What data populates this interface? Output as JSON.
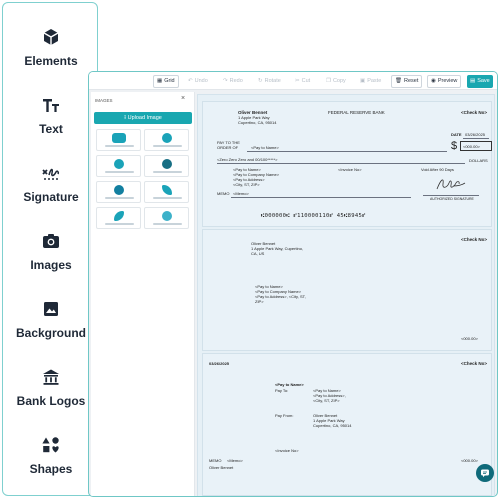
{
  "sidebar": {
    "items": [
      {
        "label": "Elements",
        "icon": "cube-icon"
      },
      {
        "label": "Text",
        "icon": "text-size-icon"
      },
      {
        "label": "Signature",
        "icon": "signature-icon"
      },
      {
        "label": "Images",
        "icon": "camera-icon"
      },
      {
        "label": "Background",
        "icon": "image-icon"
      },
      {
        "label": "Bank Logos",
        "icon": "bank-icon"
      },
      {
        "label": "Shapes",
        "icon": "shapes-icon"
      }
    ]
  },
  "toolbar": {
    "grid": "Grid",
    "undo": "Undo",
    "redo": "Redo",
    "rotate": "Rotate",
    "cut": "Cut",
    "copy": "Copy",
    "paste": "Paste",
    "reset": "Reset",
    "preview": "Preview",
    "save": "Save"
  },
  "images_panel": {
    "title": "IMAGES",
    "close": "×",
    "upload_label": "Upload Image"
  },
  "check1": {
    "payer_name": "Oliver Bennet",
    "payer_addr1": "1 Apple Park Way",
    "payer_addr2": "Cupertino, CA, 95014",
    "bank": "FEDERAL RESERVE BANK",
    "check_no": "<Check No>",
    "date_label": "DATE",
    "date": "03/26/2025",
    "pay_to_line1": "PAY TO THE",
    "pay_to_line2": "ORDER OF",
    "payee": "<Pay to Name>",
    "dollar_sign": "$",
    "amount": "<000.00>",
    "amount_words": "<Zero Zero Zero and 00/100*****>",
    "dollars": "DOLLARS",
    "addr_name": "<Pay to Name>",
    "addr_company": "<Pay to Company Name>",
    "addr_line": "<Pay to Address>",
    "addr_city": "<City, ST, ZIP>",
    "invoice": "<Invoice No>",
    "void": "Void After 90 Days",
    "memo_label": "MEMO",
    "memo": "<Memo>",
    "auth_sig": "AUTHORIZED SIGNATURE",
    "micr": "⑆000000⑆ ⑈110000110⑈ 45⑆8945⑈"
  },
  "stub1": {
    "payer_name": "Oliver Bennet",
    "payer_addr1": "1 Apple Park Way, Cupertino,",
    "payer_addr2": "CA, US",
    "check_no": "<Check No>",
    "to_name": "<Pay to Name>",
    "to_company": "<Pay to Company Name>",
    "to_address": "<Pay to Address>, <City, ST,",
    "to_zip": "ZIP>",
    "amount": "<000.00>"
  },
  "stub2": {
    "date": "03/26/2025",
    "check_no": "<Check No>",
    "pay_to_name": "<Pay to Name>",
    "pay_to_label": "Pay To:",
    "pt_name": "<Pay to Name>",
    "pt_address": "<Pay to Address>,",
    "pt_city": "<City, ST, ZIP>",
    "pay_from_label": "Pay From:",
    "pf_name": "Oliver Bennet",
    "pf_addr1": "1 Apple Park Way",
    "pf_addr2": "Cupertino, CA, 95014",
    "invoice": "<Invoice No>",
    "memo_label": "MEMO",
    "memo": "<Memo>",
    "amount": "<000.00>",
    "payer_name": "Oliver Bennet"
  }
}
